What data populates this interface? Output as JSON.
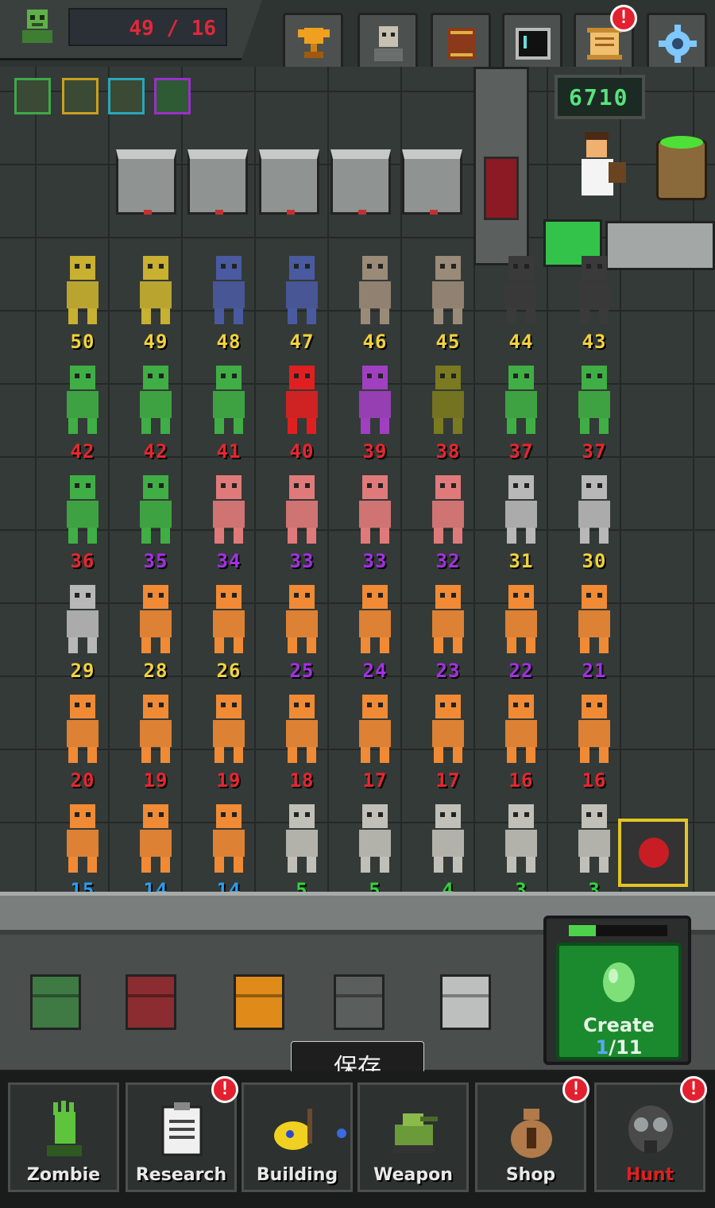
{
  "hud": {
    "hp": "49 / 16",
    "coins": "6710"
  },
  "top_buttons": [
    {
      "name": "trophy-button",
      "icon": "trophy-icon",
      "badge": ""
    },
    {
      "name": "zombie-portrait-button",
      "icon": "zombie-portrait-icon",
      "badge": ""
    },
    {
      "name": "book-button",
      "icon": "book-icon",
      "badge": ""
    },
    {
      "name": "tablet-button",
      "icon": "tablet-icon",
      "badge": ""
    },
    {
      "name": "scroll-button",
      "icon": "scroll-icon",
      "badge": "!"
    },
    {
      "name": "settings-button",
      "icon": "gear-icon",
      "badge": ""
    }
  ],
  "zombies": [
    [
      "50",
      "49",
      "48",
      "47",
      "46",
      "45",
      "44",
      "43"
    ],
    [
      "42",
      "42",
      "41",
      "40",
      "39",
      "38",
      "37",
      "37"
    ],
    [
      "36",
      "35",
      "34",
      "33",
      "33",
      "32",
      "31",
      "30"
    ],
    [
      "29",
      "28",
      "26",
      "25",
      "24",
      "23",
      "22",
      "21"
    ],
    [
      "20",
      "19",
      "19",
      "18",
      "17",
      "17",
      "16",
      "16"
    ],
    [
      "15",
      "14",
      "14",
      "5",
      "5",
      "4",
      "3",
      "3"
    ]
  ],
  "level_colors": {
    "yellow": "#f2d23a",
    "orange": "#f0902a",
    "red": "#e8262e",
    "purple": "#a62ee6",
    "blue": "#2a9ef0",
    "green": "#30d43a"
  },
  "create": {
    "label": "Create",
    "current": "1",
    "total": "/11"
  },
  "toast": "保存",
  "nav": {
    "zombie": "Zombie",
    "research": "Research",
    "building": "Building",
    "weapon": "Weapon",
    "shop": "Shop",
    "hunt": "Hunt",
    "badge": "!"
  }
}
